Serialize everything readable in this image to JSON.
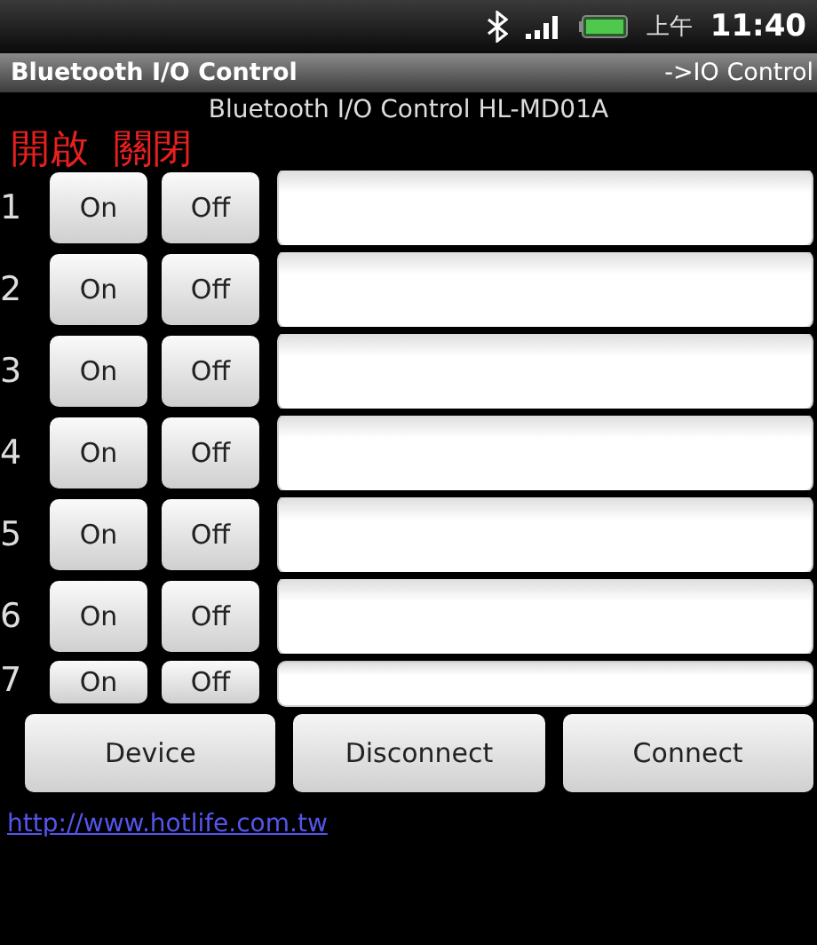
{
  "status_bar": {
    "period": "上午",
    "time": "11:40"
  },
  "title_bar": {
    "title": "Bluetooth I/O Control",
    "right": "->IO Control"
  },
  "subtitle": "Bluetooth I/O Control HL-MD01A",
  "annotations": [
    "開啟",
    "關閉"
  ],
  "rows": [
    {
      "kind": "full",
      "number": "1",
      "on": "On",
      "off": "Off"
    },
    {
      "kind": "full",
      "number": "2",
      "on": "On",
      "off": "Off"
    },
    {
      "kind": "full",
      "number": "3",
      "on": "On",
      "off": "Off"
    },
    {
      "kind": "full",
      "number": "4",
      "on": "On",
      "off": "Off"
    },
    {
      "kind": "full",
      "number": "5",
      "on": "On",
      "off": "Off"
    },
    {
      "kind": "full",
      "number": "6",
      "on": "On",
      "off": "Off"
    },
    {
      "kind": "partial",
      "number": "7",
      "on": "On",
      "off": "Off"
    }
  ],
  "buttons": [
    "Device",
    "Disconnect",
    "Connect"
  ],
  "link": "http://www.hotlife.com.tw"
}
